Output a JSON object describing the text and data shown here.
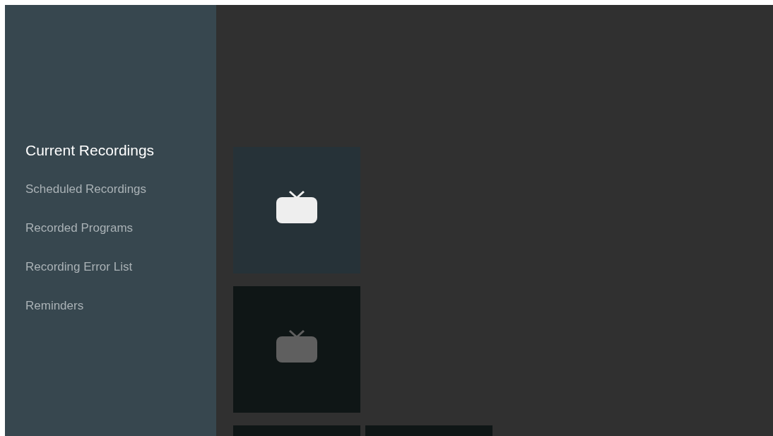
{
  "sidebar": {
    "items": [
      {
        "label": "Current Recordings",
        "selected": true
      },
      {
        "label": "Scheduled Recordings",
        "selected": false
      },
      {
        "label": "Recorded Programs",
        "selected": false
      },
      {
        "label": "Recording Error List",
        "selected": false
      },
      {
        "label": "Reminders",
        "selected": false
      }
    ]
  },
  "grid": {
    "rows": [
      [
        {
          "selected": true
        }
      ],
      [
        {
          "selected": false
        }
      ],
      [
        {
          "selected": false
        },
        {
          "selected": false
        }
      ]
    ]
  }
}
